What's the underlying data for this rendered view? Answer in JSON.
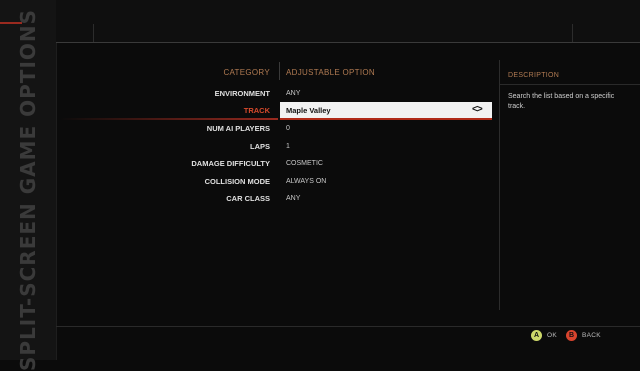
{
  "screen": {
    "side_title": "SPLIT-SCREEN GAME OPTIONS"
  },
  "table": {
    "category_header": "CATEGORY",
    "option_header": "ADJUSTABLE OPTION",
    "rows": [
      {
        "label": "ENVIRONMENT",
        "value": "ANY"
      },
      {
        "label": "TRACK",
        "value": "Maple Valley",
        "selected": true
      },
      {
        "label": "NUM AI PLAYERS",
        "value": "0"
      },
      {
        "label": "LAPS",
        "value": "1"
      },
      {
        "label": "DAMAGE DIFFICULTY",
        "value": "COSMETIC"
      },
      {
        "label": "COLLISION MODE",
        "value": "ALWAYS ON"
      },
      {
        "label": "CAR CLASS",
        "value": "ANY"
      }
    ],
    "arrows_icon": "left-right-arrows-icon"
  },
  "description": {
    "header": "DESCRIPTION",
    "text": "Search the list based on a specific track."
  },
  "footer": {
    "ok": {
      "glyph": "A",
      "label": "OK",
      "color": "#cdd86a"
    },
    "back": {
      "glyph": "B",
      "label": "BACK",
      "color": "#d8442e"
    }
  },
  "colors": {
    "accent_red": "#d74a2c",
    "header_orange": "#b07a52",
    "background": "#0b0b0b"
  }
}
